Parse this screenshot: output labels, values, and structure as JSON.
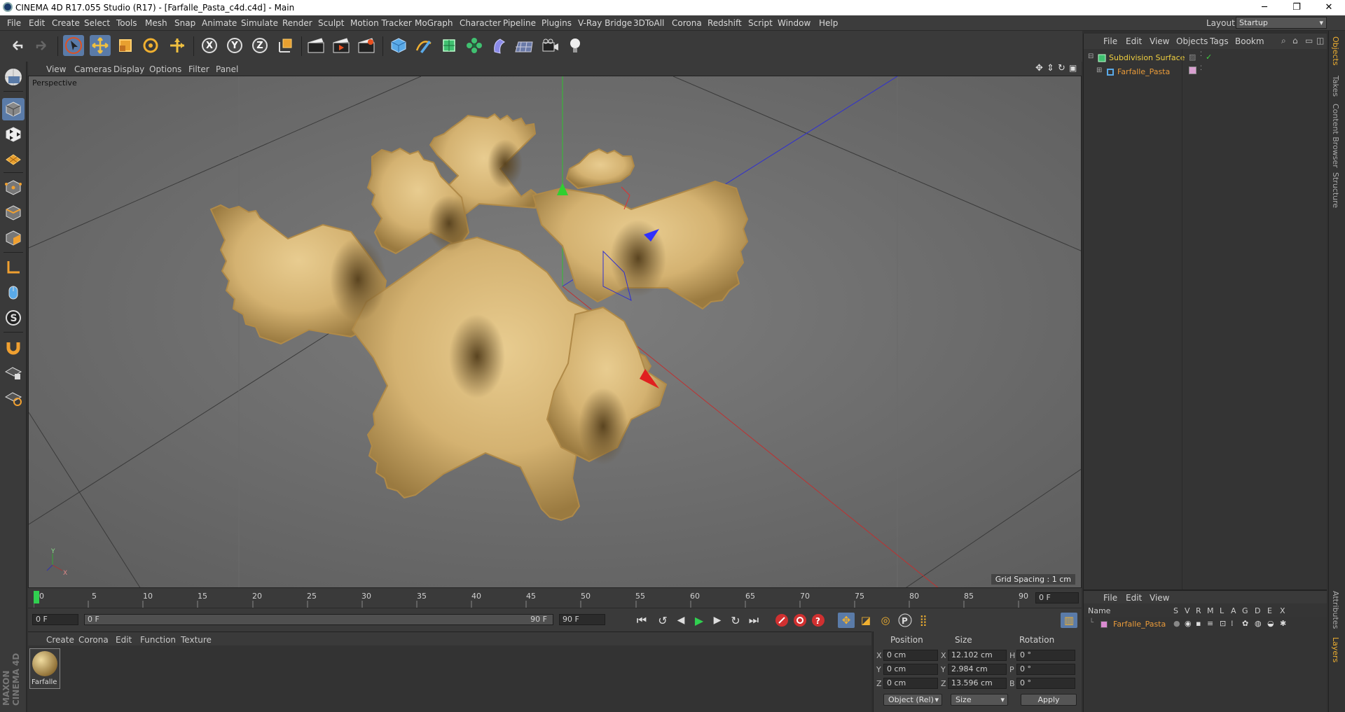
{
  "window": {
    "title": "CINEMA 4D R17.055 Studio (R17) - [Farfalle_Pasta_c4d.c4d] - Main",
    "controls": [
      "─",
      "❐",
      "✕"
    ]
  },
  "menubar": {
    "items": [
      "File",
      "Edit",
      "Create",
      "Select",
      "Tools",
      "Mesh",
      "Snap",
      "Animate",
      "Simulate",
      "Render",
      "Sculpt",
      "Motion Tracker",
      "MoGraph",
      "Character",
      "Pipeline",
      "Plugins",
      "V-Ray Bridge",
      "3DToAll",
      "Corona",
      "Redshift",
      "Script",
      "Window",
      "Help"
    ],
    "layout_label": "Layout:",
    "layout_value": "Startup"
  },
  "viewport": {
    "menu": [
      "View",
      "Cameras",
      "Display",
      "Options",
      "Filter",
      "Panel"
    ],
    "camera_label": "Perspective",
    "grid_spacing": "Grid Spacing : 1 cm"
  },
  "timeline": {
    "ticks": [
      "0",
      "5",
      "10",
      "15",
      "20",
      "25",
      "30",
      "35",
      "40",
      "45",
      "50",
      "55",
      "60",
      "65",
      "70",
      "75",
      "80",
      "85",
      "90"
    ],
    "current_frame": "0 F",
    "start_field": "0 F",
    "range_start": "0 F",
    "range_end": "90 F",
    "end_field": "90 F"
  },
  "material_manager": {
    "menu": [
      "Create",
      "Corona",
      "Edit",
      "Function",
      "Texture"
    ],
    "material_name": "Farfalle"
  },
  "coordinates": {
    "headers": [
      "Position",
      "Size",
      "Rotation"
    ],
    "rows": [
      {
        "axis": "X",
        "pos": "0 cm",
        "size_axis": "X",
        "size": "12.102 cm",
        "rot_axis": "H",
        "rot": "0 °"
      },
      {
        "axis": "Y",
        "pos": "0 cm",
        "size_axis": "Y",
        "size": "2.984 cm",
        "rot_axis": "P",
        "rot": "0 °"
      },
      {
        "axis": "Z",
        "pos": "0 cm",
        "size_axis": "Z",
        "size": "13.596 cm",
        "rot_axis": "B",
        "rot": "0 °"
      }
    ],
    "mode_select": "Object (Rel)",
    "size_select": "Size",
    "apply_label": "Apply"
  },
  "object_manager": {
    "menu": [
      "File",
      "Edit",
      "View",
      "Objects",
      "Tags",
      "Bookm"
    ],
    "objects": [
      {
        "name": "Subdivision Surface",
        "color": "#f0d040"
      },
      {
        "name": "Farfalle_Pasta",
        "color": "#e89a3a"
      }
    ]
  },
  "side_tabs": [
    "Objects",
    "Takes",
    "Content Browser",
    "Structure",
    "Attributes",
    "Layers"
  ],
  "layer_manager": {
    "menu": [
      "File",
      "Edit",
      "View"
    ],
    "columns": [
      "Name",
      "S",
      "V",
      "R",
      "M",
      "L",
      "A",
      "G",
      "D",
      "E",
      "X"
    ],
    "layer_name": "Farfalle_Pasta",
    "layer_color": "#d98ad0"
  },
  "branding": "MAXON CINEMA 4D"
}
